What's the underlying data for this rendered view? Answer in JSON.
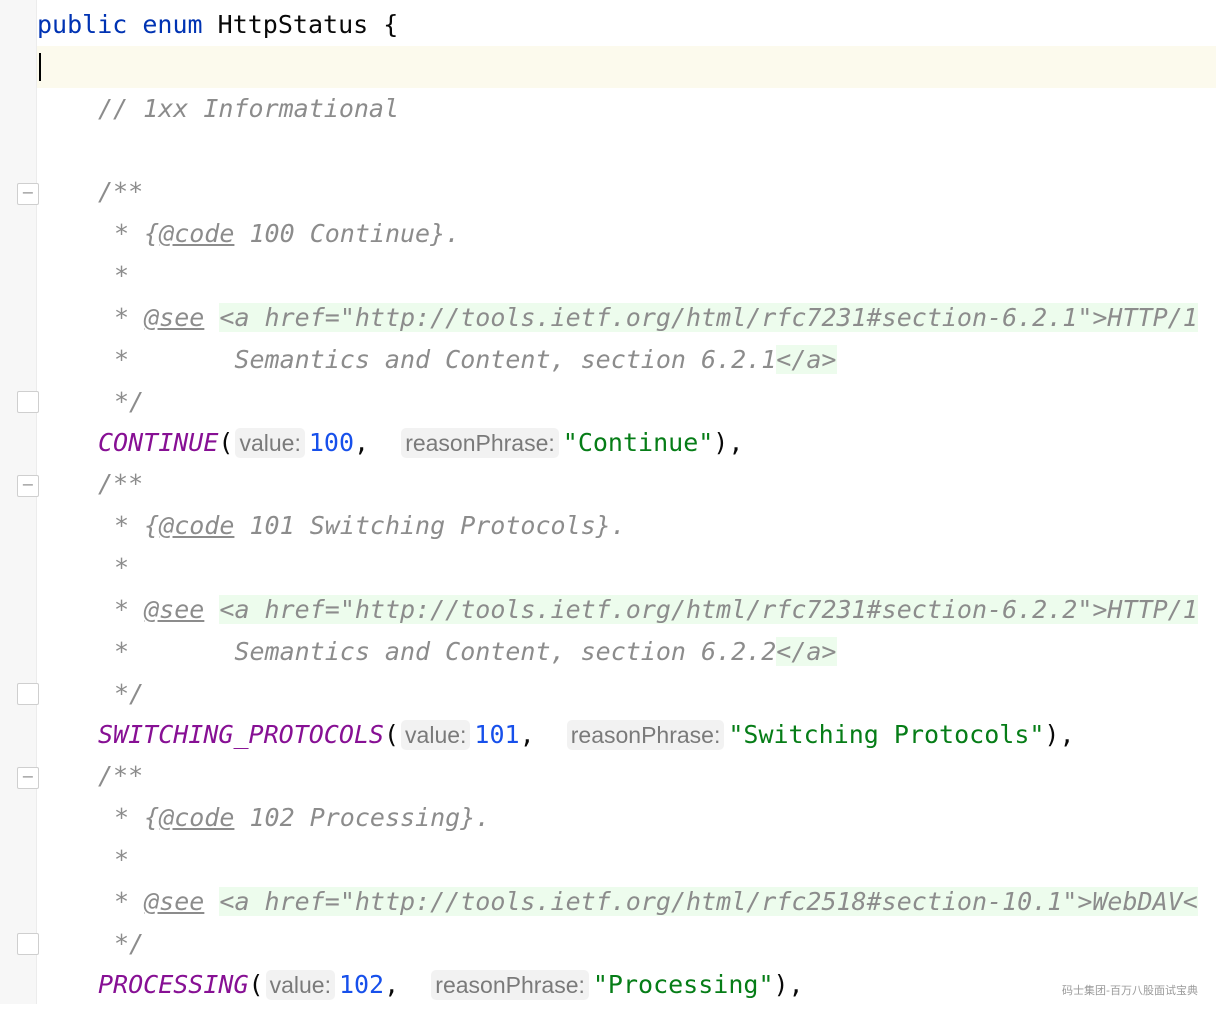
{
  "decl": {
    "modifier": "public",
    "keyword": "enum",
    "name": "HttpStatus",
    "brace": "{"
  },
  "section_comment": "// 1xx Informational",
  "blocks": [
    {
      "doc_open": "/**",
      "code_prefix": "* {",
      "code_tag": "@code",
      "code_text": "100 Continue}.",
      "star": "*",
      "see_tag": "@see",
      "anchor_open": "<a href=\"http://tools.ietf.org/html/rfc7231#section-6.2.1\">HTTP/1",
      "cont_text": "Semantics and Content, section 6.2.1",
      "anchor_close": "</a>",
      "doc_close": "*/",
      "const_name": "CONTINUE",
      "hint_value": "value:",
      "value": "100",
      "hint_reason": "reasonPhrase:",
      "reason": "\"Continue\""
    },
    {
      "doc_open": "/**",
      "code_prefix": "* {",
      "code_tag": "@code",
      "code_text": "101 Switching Protocols}.",
      "star": "*",
      "see_tag": "@see",
      "anchor_open": "<a href=\"http://tools.ietf.org/html/rfc7231#section-6.2.2\">HTTP/1",
      "cont_text": "Semantics and Content, section 6.2.2",
      "anchor_close": "</a>",
      "doc_close": "*/",
      "const_name": "SWITCHING_PROTOCOLS",
      "hint_value": "value:",
      "value": "101",
      "hint_reason": "reasonPhrase:",
      "reason": "\"Switching Protocols\""
    },
    {
      "doc_open": "/**",
      "code_prefix": "* {",
      "code_tag": "@code",
      "code_text": "102 Processing}.",
      "star": "*",
      "see_tag": "@see",
      "anchor_open": "<a href=\"http://tools.ietf.org/html/rfc2518#section-10.1\">WebDAV<",
      "doc_close": "*/",
      "const_name": "PROCESSING",
      "hint_value": "value:",
      "value": "102",
      "hint_reason": "reasonPhrase:",
      "reason": "\"Processing\""
    }
  ],
  "punct": {
    "open_paren": "(",
    "comma": ",",
    "close": "),"
  },
  "fold_icon": "−",
  "watermark": "码士集团-百万八股面试宝典",
  "colors": {
    "keyword": "#0033b3",
    "comment": "#8c8c8c",
    "enum_constant": "#871094",
    "number": "#1750eb",
    "string": "#067d17",
    "html_highlight": "#edfced",
    "current_line": "#fcfaed"
  }
}
